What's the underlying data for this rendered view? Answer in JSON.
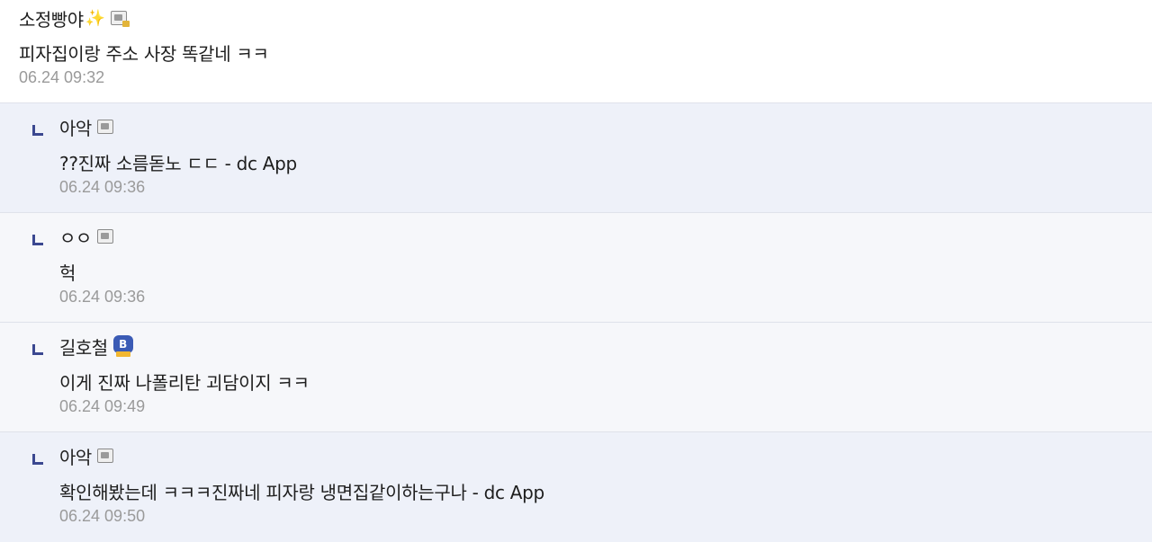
{
  "comments": [
    {
      "nick": "소정빵야",
      "nick_emoji": "✨",
      "text": "피자집이랑 주소 사장 똑같네 ㅋㅋ",
      "date": "06.24 09:32"
    },
    {
      "nick": "아악",
      "text": "??진짜 소름돋노 ㄷㄷ - dc App",
      "date": "06.24 09:36"
    },
    {
      "nick": "ㅇㅇ",
      "text": "헉",
      "date": "06.24 09:36"
    },
    {
      "nick": "길호철",
      "badge_letter": "B",
      "text": "이게 진짜 나폴리탄 괴담이지 ㅋㅋ",
      "date": "06.24 09:49"
    },
    {
      "nick": "아악",
      "text": "확인해봤는데 ㅋㅋㅋ진짜네 피자랑 냉면집같이하는구나 - dc App",
      "date": "06.24 09:50"
    }
  ],
  "colors": {
    "reply_bg_blue": "#eef1f9",
    "reply_bg_grey": "#f6f7fa",
    "reply_arrow": "#3b4890",
    "badge_blue": "#3b5bb5",
    "badge_ribbon": "#f2b730",
    "date_text": "#9a9a9a"
  },
  "icons": {
    "fixed_nick": "fixed-nick-icon",
    "fixed_nick_locked": "fixed-nick-lock-icon",
    "reply_arrow": "reply-arrow-icon",
    "manager_badge": "manager-badge-icon"
  }
}
